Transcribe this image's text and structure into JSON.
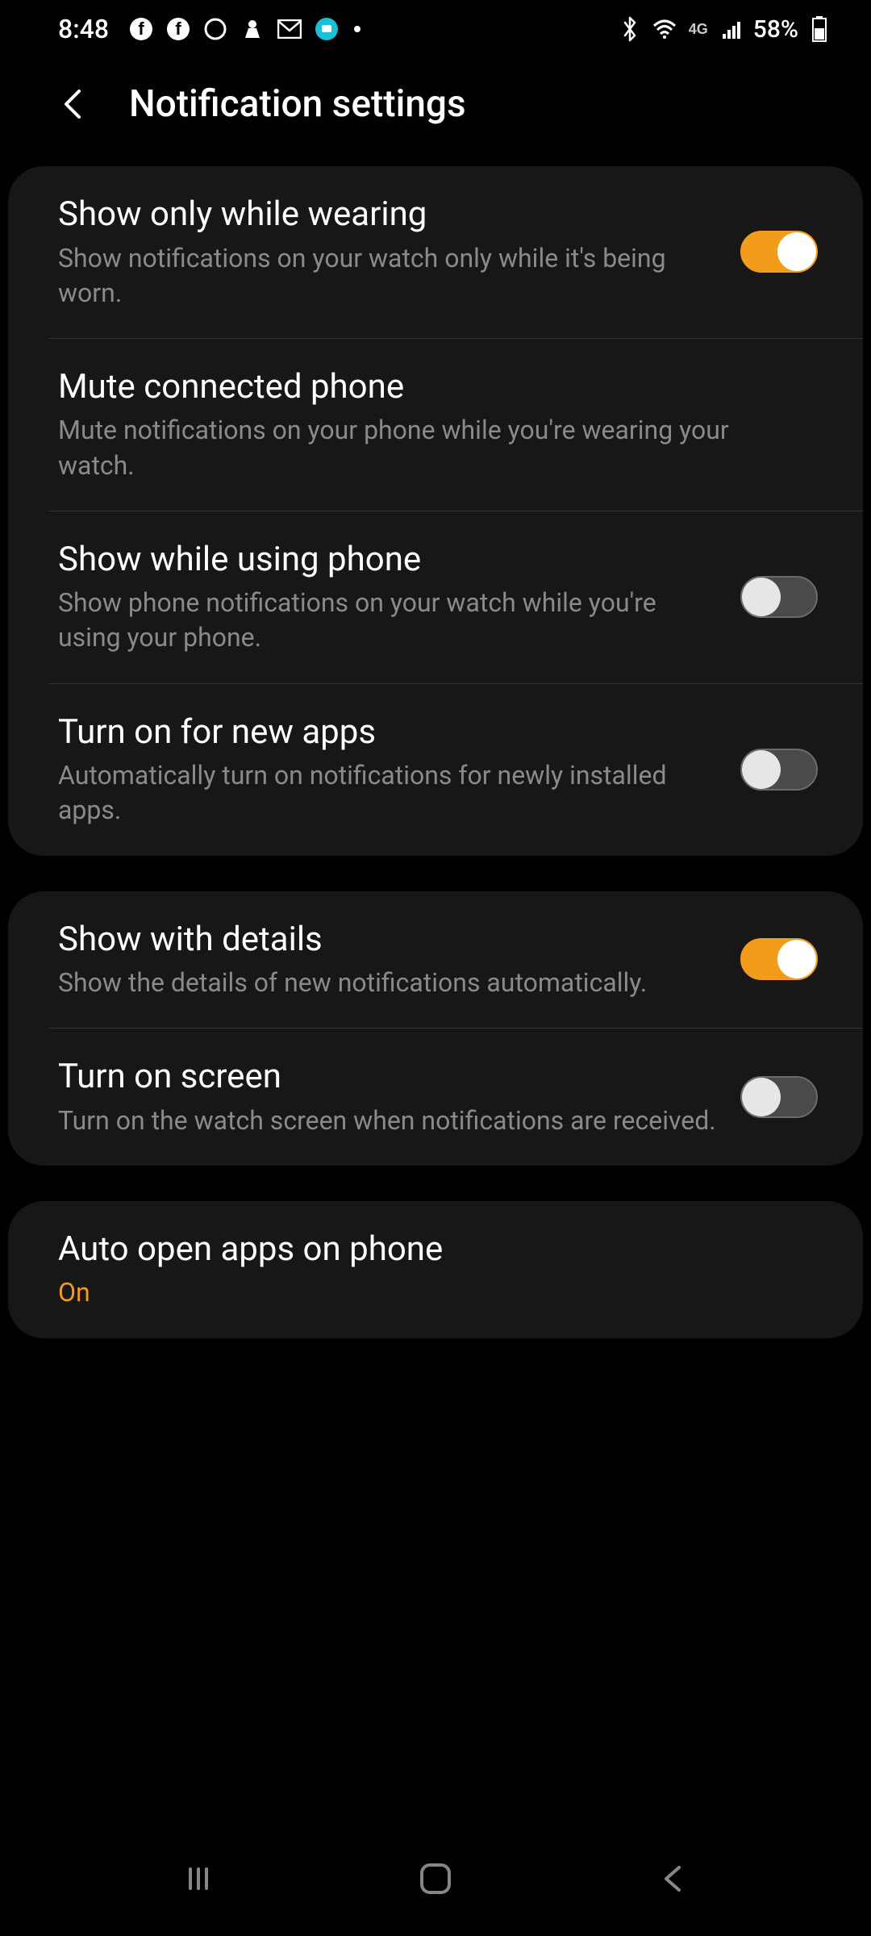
{
  "status": {
    "time": "8:48",
    "battery": "58%",
    "network_label": "4G"
  },
  "header": {
    "title": "Notification settings"
  },
  "groups": [
    {
      "rows": [
        {
          "title": "Show only while wearing",
          "sub": "Show notifications on your watch only while it's being worn.",
          "toggle": true,
          "toggle_on": true
        },
        {
          "title": "Mute connected phone",
          "sub": "Mute notifications on your phone while you're wearing your watch.",
          "toggle": false
        },
        {
          "title": "Show while using phone",
          "sub": "Show phone notifications on your watch while you're using your phone.",
          "toggle": true,
          "toggle_on": false
        },
        {
          "title": "Turn on for new apps",
          "sub": "Automatically turn on notifications for newly installed apps.",
          "toggle": true,
          "toggle_on": false
        }
      ]
    },
    {
      "rows": [
        {
          "title": "Show with details",
          "sub": "Show the details of new notifications automatically.",
          "toggle": true,
          "toggle_on": true
        },
        {
          "title": "Turn on screen",
          "sub": "Turn on the watch screen when notifications are received.",
          "toggle": true,
          "toggle_on": false
        }
      ]
    },
    {
      "rows": [
        {
          "title": "Auto open apps on phone",
          "sub": "On",
          "sub_accent": true,
          "toggle": false
        }
      ]
    }
  ]
}
